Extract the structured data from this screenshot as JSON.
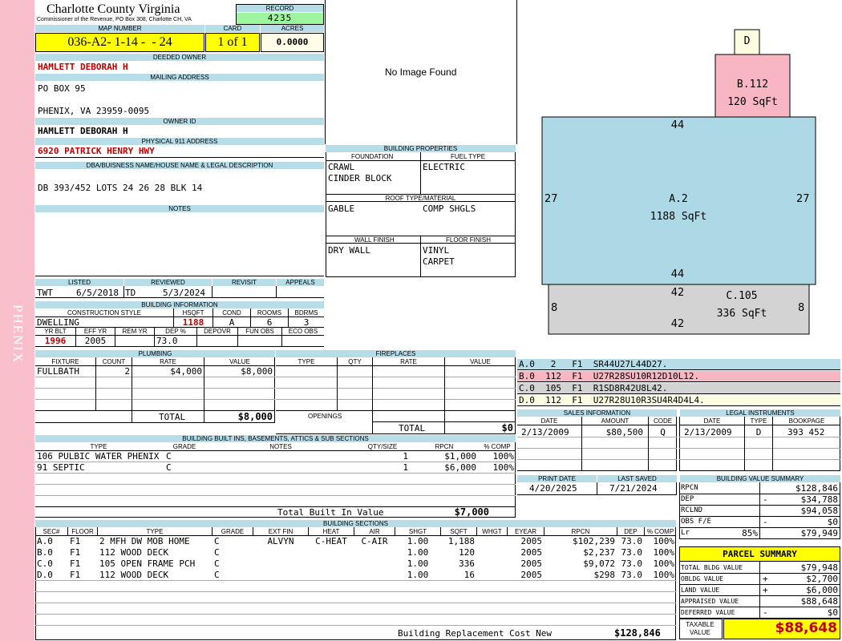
{
  "county": {
    "name": "Charlotte County Virginia",
    "subtitle": "Commissioner of the Revenue, PO Box 308, Charlotte CH, VA",
    "side_label": "PHENIX"
  },
  "record": {
    "label": "RECORD",
    "value": "4235"
  },
  "map_number": {
    "label": "MAP NUMBER",
    "value": "036-A2- 1-14 -  - 24"
  },
  "card": {
    "label": "CARD",
    "value": "1 of 1"
  },
  "acres": {
    "label": "ACRES",
    "value": "0.0000"
  },
  "deeded_owner": {
    "label": "DEEDED OWNER",
    "value": "HAMLETT DEBORAH H"
  },
  "mailing": {
    "label": "MAILING ADDRESS",
    "line1": "PO BOX 95",
    "line2": "PHENIX, VA 23959-0095"
  },
  "owner_id": {
    "label": "OWNER ID",
    "value": "HAMLETT DEBORAH H"
  },
  "physical": {
    "label": "PHYSICAL 911 ADDRESS",
    "value": "6920 PATRICK HENRY HWY"
  },
  "legal": {
    "label": "DBA/BUISNESS NAME/HOUSE NAME & LEGAL DESCRIPTION",
    "value": "DB 393/452 LOTS 24 26 28 BLK 14"
  },
  "notes": {
    "label": "NOTES"
  },
  "image": {
    "text": "No Image Found"
  },
  "status": {
    "headers": [
      "LISTED",
      "REVIEWED",
      "REVISIT",
      "APPEALS"
    ],
    "listed_by": "TWT",
    "listed_date": "6/5/2018",
    "reviewed_by": "TD",
    "reviewed_date": "5/3/2024"
  },
  "building_info": {
    "label": "BUILDING INFORMATION",
    "h1": [
      "CONSTRUCTION STYLE",
      "HSQFT",
      "COND",
      "ROOMS",
      "BDRMS"
    ],
    "v1": [
      "DWELLING",
      "1188",
      "A",
      "6",
      "3"
    ],
    "h2": [
      "YR BLT",
      "EFF YR",
      "REM YR",
      "DEP %",
      "DEPOVR",
      "FUN OBS",
      "ECO OBS"
    ],
    "v2": [
      "1996",
      "2005",
      "",
      "73.0",
      "",
      "",
      ""
    ]
  },
  "building_props": {
    "label": "BUILDING PROPERTIES",
    "foundation_label": "FOUNDATION",
    "foundation": [
      "CRAWL",
      "CINDER BLOCK"
    ],
    "fuel_label": "FUEL TYPE",
    "fuel": "ELECTRIC",
    "roof_label": "ROOF TYPE/MATERIAL",
    "roof_type": "GABLE",
    "roof_material": "COMP SHGLS",
    "wall_label": "WALL FINISH",
    "wall": "DRY WALL",
    "floor_label": "FLOOR FINISH",
    "floor": [
      "VINYL",
      "CARPET"
    ]
  },
  "plumbing": {
    "label": "PLUMBING",
    "headers": [
      "FIXTURE",
      "COUNT",
      "RATE",
      "VALUE"
    ],
    "rows": [
      [
        "FULLBATH",
        "2",
        "$4,000",
        "$8,000"
      ]
    ],
    "total_label": "TOTAL",
    "total": "$8,000"
  },
  "fireplaces": {
    "label": "FIREPLACES",
    "headers": [
      "TYPE",
      "QTY",
      "RATE",
      "VALUE"
    ],
    "openings_label": "OPENINGS",
    "total_label": "TOTAL",
    "total": "$0"
  },
  "built_ins": {
    "label": "BUILDING BUILT INS, BASEMENTS, ATTICS & SUB SECTIONS",
    "headers": [
      "TYPE",
      "GRADE",
      "NOTES",
      "QTY/SIZE",
      "RPCN",
      "% COMP"
    ],
    "rows": [
      [
        "106 PULBIC WATER PHENIX",
        "C",
        "",
        "1",
        "$1,000",
        "100%"
      ],
      [
        "91 SEPTIC",
        "C",
        "",
        "1",
        "$6,000",
        "100%"
      ]
    ],
    "total_label": "Total Built In Value",
    "total": "$7,000"
  },
  "sketch": {
    "labels": [
      {
        "id": "D",
        "text": "D"
      },
      {
        "id": "B",
        "name": "B.112",
        "area": "120 SqFt"
      },
      {
        "id": "A",
        "name": "A.2",
        "area": "1188 SqFt",
        "top": "44",
        "bottom": "44",
        "left": "27",
        "right": "27"
      },
      {
        "id": "C",
        "name": "C.105",
        "area": "336 SqFt",
        "top": "42",
        "bottom": "42",
        "left": "8",
        "right": "8"
      }
    ]
  },
  "sketch_codes": [
    {
      "text": "A.0   2   F1  SR44U27L44D27.",
      "color": "#b7dde8"
    },
    {
      "text": "B.0  112  F1  U27R28SU10R12D10L12.",
      "color": "#f7b6c2"
    },
    {
      "text": "C.0  105  F1  R1SD8R42U8L42.",
      "color": "#d3d3d3"
    },
    {
      "text": "D.0  112  F1  U27R28U10R3SU4R4D4L4.",
      "color": "#fdfbe0"
    }
  ],
  "sales": {
    "label": "SALES INFORMATION",
    "headers": [
      "DATE",
      "AMOUNT",
      "CODE"
    ],
    "rows": [
      [
        "2/13/2009",
        "$80,500",
        "Q"
      ]
    ]
  },
  "legal_instruments": {
    "label": "LEGAL INSTRUMENTS",
    "headers": [
      "DATE",
      "TYPE",
      "BOOKPAGE"
    ],
    "rows": [
      [
        "2/13/2009",
        "D",
        "393 452"
      ]
    ]
  },
  "print": {
    "print_label": "PRINT DATE",
    "print_date": "4/20/2025",
    "saved_label": "LAST SAVED",
    "saved_date": "7/21/2024"
  },
  "bvs": {
    "label": "BUILDING VALUE SUMMARY",
    "rows": [
      {
        "label": "RPCN",
        "extra": "",
        "sign": "",
        "value": "$128,846"
      },
      {
        "label": "DEP",
        "extra": "",
        "sign": "-",
        "value": "$34,788"
      },
      {
        "label": "RCLND",
        "extra": "",
        "sign": "",
        "value": "$94,058"
      },
      {
        "label": "OBS F/E",
        "extra": "",
        "sign": "-",
        "value": "$0"
      },
      {
        "label": "Lr",
        "extra": "85%",
        "sign": "",
        "value": "$79,949"
      }
    ]
  },
  "parcel": {
    "label": "PARCEL SUMMARY",
    "rows": [
      {
        "label": "TOTAL BLDG VALUE",
        "sign": "",
        "value": "$79,948"
      },
      {
        "label": "OBLDG VALUE",
        "sign": "+",
        "value": "$2,700"
      },
      {
        "label": "LAND VALUE",
        "sign": "+",
        "value": "$6,000"
      },
      {
        "label": "APPRAISED VALUE",
        "sign": "",
        "value": "$88,648"
      },
      {
        "label": "DEFERRED VALUE",
        "sign": "-",
        "value": "$0"
      }
    ],
    "taxable_label": "TAXABLE VALUE",
    "taxable": "$88,648"
  },
  "sections": {
    "label": "BUILDING SECTIONS",
    "headers": [
      "SEC#",
      "FLOOR",
      "TYPE",
      "GRADE",
      "EXT FIN",
      "HEAT",
      "AIR",
      "SHGT",
      "SQFT",
      "WHGT",
      "EYEAR",
      "RPCN",
      "DEP",
      "% COMP"
    ],
    "rows": [
      [
        "A.0",
        "F1",
        "2 MFH DW MOB HOME",
        "C",
        "ALVYN",
        "C-HEAT",
        "C-AIR",
        "1.00",
        "1,188",
        "",
        "2005",
        "$102,239",
        "73.0",
        "100%"
      ],
      [
        "B.0",
        "F1",
        "112 WOOD DECK",
        "C",
        "",
        "",
        "",
        "1.00",
        "120",
        "",
        "2005",
        "$2,237",
        "73.0",
        "100%"
      ],
      [
        "C.0",
        "F1",
        "105 OPEN FRAME PCH",
        "C",
        "",
        "",
        "",
        "1.00",
        "336",
        "",
        "2005",
        "$9,072",
        "73.0",
        "100%"
      ],
      [
        "D.0",
        "F1",
        "112 WOOD DECK",
        "C",
        "",
        "",
        "",
        "1.00",
        "16",
        "",
        "2005",
        "$298",
        "73.0",
        "100%"
      ]
    ],
    "footer_label": "Building Replacement Cost New",
    "footer_value": "$128,846"
  }
}
